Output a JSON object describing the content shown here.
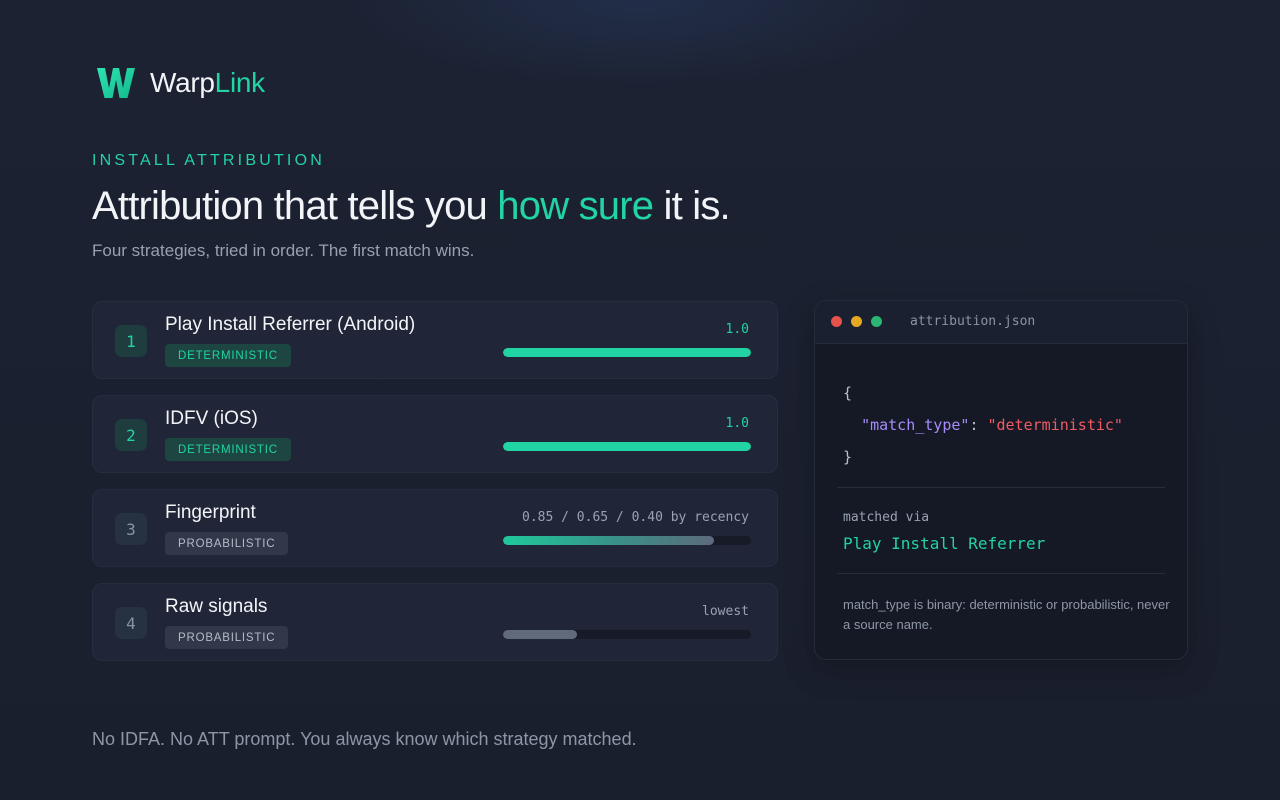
{
  "brand": {
    "name_part1": "Warp",
    "name_part2": "Link",
    "logo_icon": "w-logo-icon",
    "accent_color": "#22d3a4"
  },
  "hero": {
    "eyebrow": "INSTALL ATTRIBUTION",
    "headline_before": "Attribution that tells you ",
    "headline_accent": "how sure",
    "headline_after": " it is.",
    "subhead": "Four strategies, tried in order. The first match wins."
  },
  "strategies": [
    {
      "number": "1",
      "title": "Play Install Referrer (Android)",
      "badge": "DETERMINISTIC",
      "kind": "deterministic",
      "score_label": "1.0",
      "confidence": 1.0
    },
    {
      "number": "2",
      "title": "IDFV (iOS)",
      "badge": "DETERMINISTIC",
      "kind": "deterministic",
      "score_label": "1.0",
      "confidence": 1.0
    },
    {
      "number": "3",
      "title": "Fingerprint",
      "badge": "PROBABILISTIC",
      "kind": "probabilistic",
      "score_label": "0.85 / 0.65 / 0.40 by recency",
      "confidence": 0.85
    },
    {
      "number": "4",
      "title": "Raw signals",
      "badge": "PROBABILISTIC",
      "kind": "probabilistic",
      "score_label": "lowest",
      "confidence": 0.3
    }
  ],
  "code_panel": {
    "filename": "attribution.json",
    "window_dots": [
      "#e5534b",
      "#e6a823",
      "#2bb673"
    ],
    "brace_open": "{",
    "json_key": "\"match_type\"",
    "json_colon": ": ",
    "json_value": "\"deterministic\"",
    "brace_close": "}",
    "matched_via_label": "matched via",
    "matched_via_value": "Play Install Referrer",
    "note": "match_type is binary: deterministic or probabilistic, never a source name."
  },
  "footer": {
    "text": "No IDFA. No ATT prompt. You always know which strategy matched."
  }
}
